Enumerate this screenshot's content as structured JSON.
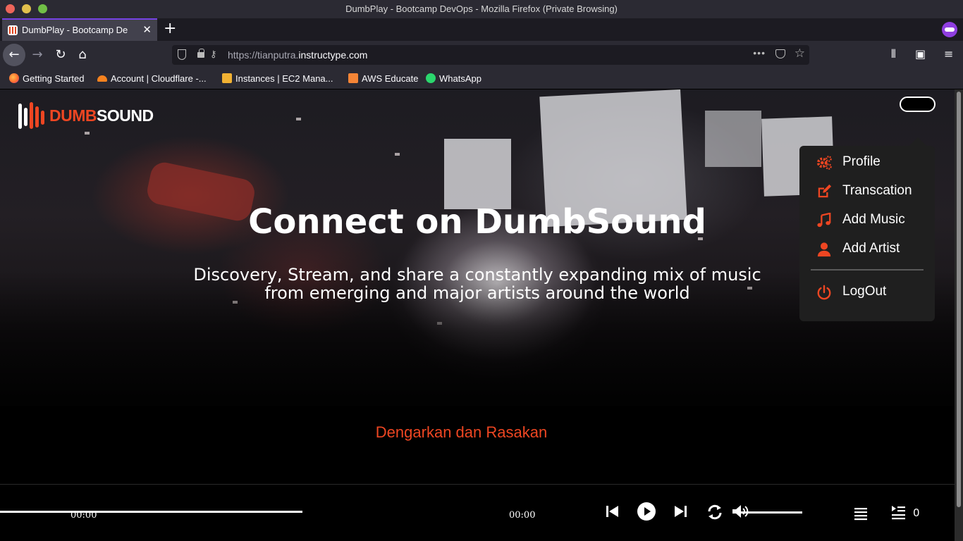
{
  "browser": {
    "window_title": "DumbPlay - Bootcamp DevOps - Mozilla Firefox (Private Browsing)",
    "tab_title": "DumbPlay - Bootcamp DevOps",
    "url_prefix": "https://tianputra.",
    "url_host": "instructype.com",
    "url_more": "•••",
    "bookmarks": [
      {
        "label": "Getting Started",
        "icon": "firefox-icon"
      },
      {
        "label": "Account | Cloudflare -...",
        "icon": "cloudflare-icon"
      },
      {
        "label": "Instances | EC2 Mana...",
        "icon": "aws-box-icon"
      },
      {
        "label": "AWS Educate",
        "icon": "aws-educate-icon"
      },
      {
        "label": "WhatsApp",
        "icon": "whatsapp-icon"
      }
    ],
    "colors": {
      "accent": "#7542e5",
      "private": "#8f3ee0"
    }
  },
  "app": {
    "logo_part1": "DUMB",
    "logo_part2": "SOUND",
    "hero_title": "Connect on DumbSound",
    "hero_subtitle": "Discovery, Stream, and share a constantly expanding mix of music from emerging and major artists around the world",
    "tagline": "Dengarkan dan Rasakan",
    "brand_color": "#ee4622",
    "menu": {
      "items": [
        {
          "label": "Profile",
          "icon": "gears-icon"
        },
        {
          "label": "Transcation",
          "icon": "edit-icon"
        },
        {
          "label": "Add Music",
          "icon": "music-note-icon"
        },
        {
          "label": "Add Artist",
          "icon": "user-icon"
        }
      ],
      "logout": {
        "label": "LogOut",
        "icon": "power-icon"
      }
    }
  },
  "player": {
    "current_time": "00:00",
    "duration": "00:00",
    "progress": 0,
    "volume": 0,
    "queue_count": "0"
  }
}
